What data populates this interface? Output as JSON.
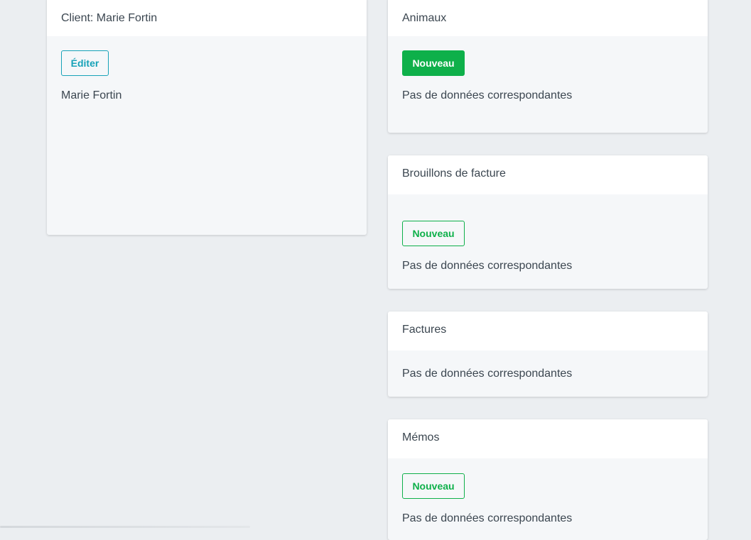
{
  "client_card": {
    "title": "Client: Marie Fortin",
    "edit_label": "Éditer",
    "client_name": "Marie Fortin"
  },
  "animals_card": {
    "title": "Animaux",
    "new_label": "Nouveau",
    "empty_text": "Pas de données correspondantes"
  },
  "drafts_card": {
    "title": "Brouillons de facture",
    "new_label": "Nouveau",
    "empty_text": "Pas de données correspondantes"
  },
  "invoices_card": {
    "title": "Factures",
    "empty_text": "Pas de données correspondantes"
  },
  "memos_card": {
    "title": "Mémos",
    "new_label": "Nouveau",
    "empty_text": "Pas de données correspondantes"
  },
  "colors": {
    "background": "#ebeef1",
    "card_body": "#f5f7f9",
    "info": "#17a2b8",
    "success": "#0eb04a",
    "text": "#3b4650"
  }
}
